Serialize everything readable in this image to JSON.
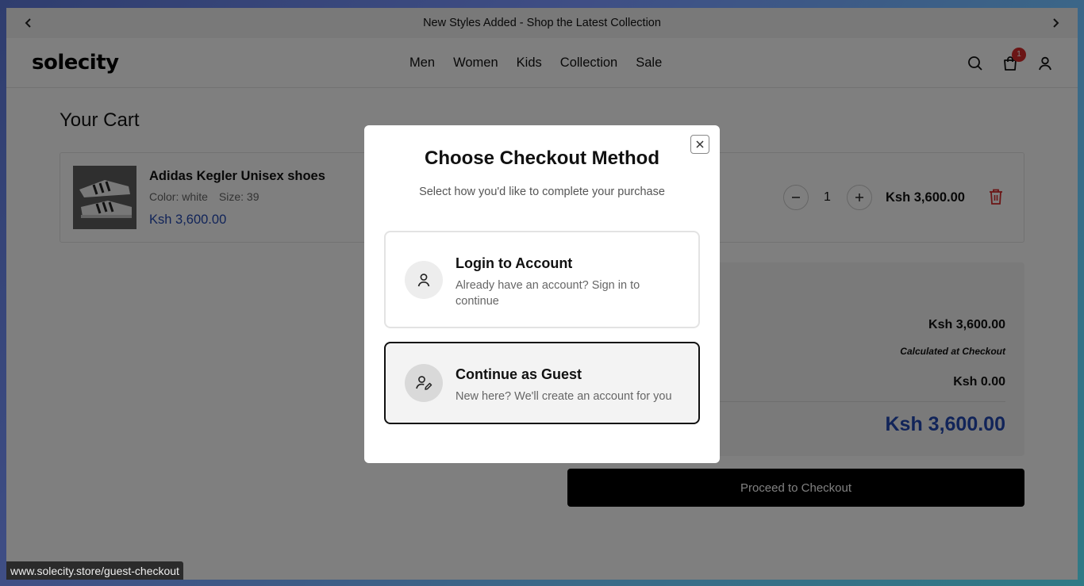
{
  "announcement": {
    "text": "New Styles Added - Shop the Latest Collection"
  },
  "header": {
    "logo": "solecity",
    "nav": [
      "Men",
      "Women",
      "Kids",
      "Collection",
      "Sale"
    ],
    "cart_count": "1"
  },
  "cart": {
    "title": "Your Cart",
    "item": {
      "name": "Adidas Kegler Unisex shoes",
      "color": "Color: white",
      "size": "Size: 39",
      "price": "Ksh 3,600.00",
      "quantity": "1",
      "line_total": "Ksh 3,600.00"
    }
  },
  "summary": {
    "subtotal": "Ksh 3,600.00",
    "shipping": "Calculated at Checkout",
    "tax": "Ksh 0.00",
    "total": "Ksh 3,600.00",
    "checkout_label": "Proceed to Checkout"
  },
  "modal": {
    "title": "Choose Checkout Method",
    "subtitle": "Select how you'd like to complete your purchase",
    "login": {
      "title": "Login to Account",
      "desc": "Already have an account? Sign in to continue"
    },
    "guest": {
      "title": "Continue as Guest",
      "desc": "New here? We'll create an account for you"
    }
  },
  "status_url": "www.solecity.store/guest-checkout",
  "colors": {
    "accent_blue": "#2348b3",
    "badge_red": "#d62a2a",
    "trash_red": "#d62a2a"
  }
}
